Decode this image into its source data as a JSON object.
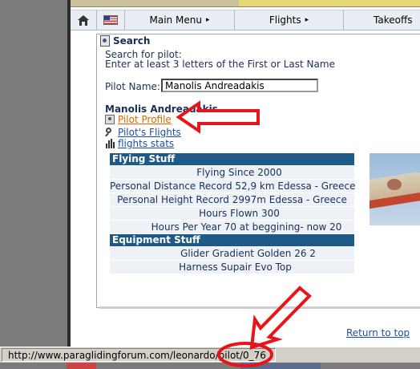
{
  "menubar": {
    "main_menu": "Main Menu",
    "flights": "Flights",
    "takeoffs": "Takeoffs",
    "arrow": "▸"
  },
  "search": {
    "title": "Search",
    "prompt_line1": "Search for pilot:",
    "prompt_line2": "Enter at least 3 letters of the First or Last Name",
    "pilot_name_label": "Pilot Name:",
    "pilot_name_value": "Manolis Andreadakis"
  },
  "result": {
    "pilot_name": "Manolis Andreadakis",
    "links": [
      {
        "label": "Pilot Profile",
        "icon": "profile-icon"
      },
      {
        "label": "Pilot's Flights",
        "icon": "magnifier-icon"
      },
      {
        "label": "flights stats",
        "icon": "bar-chart-icon"
      }
    ]
  },
  "flying_stuff": {
    "header": "Flying Stuff",
    "rows": [
      "Flying Since 2000",
      "Personal Distance Record 52,9 km Edessa - Greece",
      "Personal Height Record 2997m Edessa - Greece",
      "Hours Flown 300",
      "Hours Per Year 70 at beggining- now 20"
    ]
  },
  "equipment_stuff": {
    "header": "Equipment Stuff",
    "rows": [
      "Glider Gradient Golden 26 2",
      "Harness Supair Evo Top"
    ]
  },
  "footer": {
    "return_to_top": "Return to top"
  },
  "statusbar": {
    "url": "http://www.paraglidingforum.com/leonardo/pilot/0_76"
  },
  "colors": {
    "annotation_red": "#e8141a",
    "section_header": "#1e5a87",
    "link_blue": "#1c4f9c",
    "link_orange": "#d46a00"
  }
}
